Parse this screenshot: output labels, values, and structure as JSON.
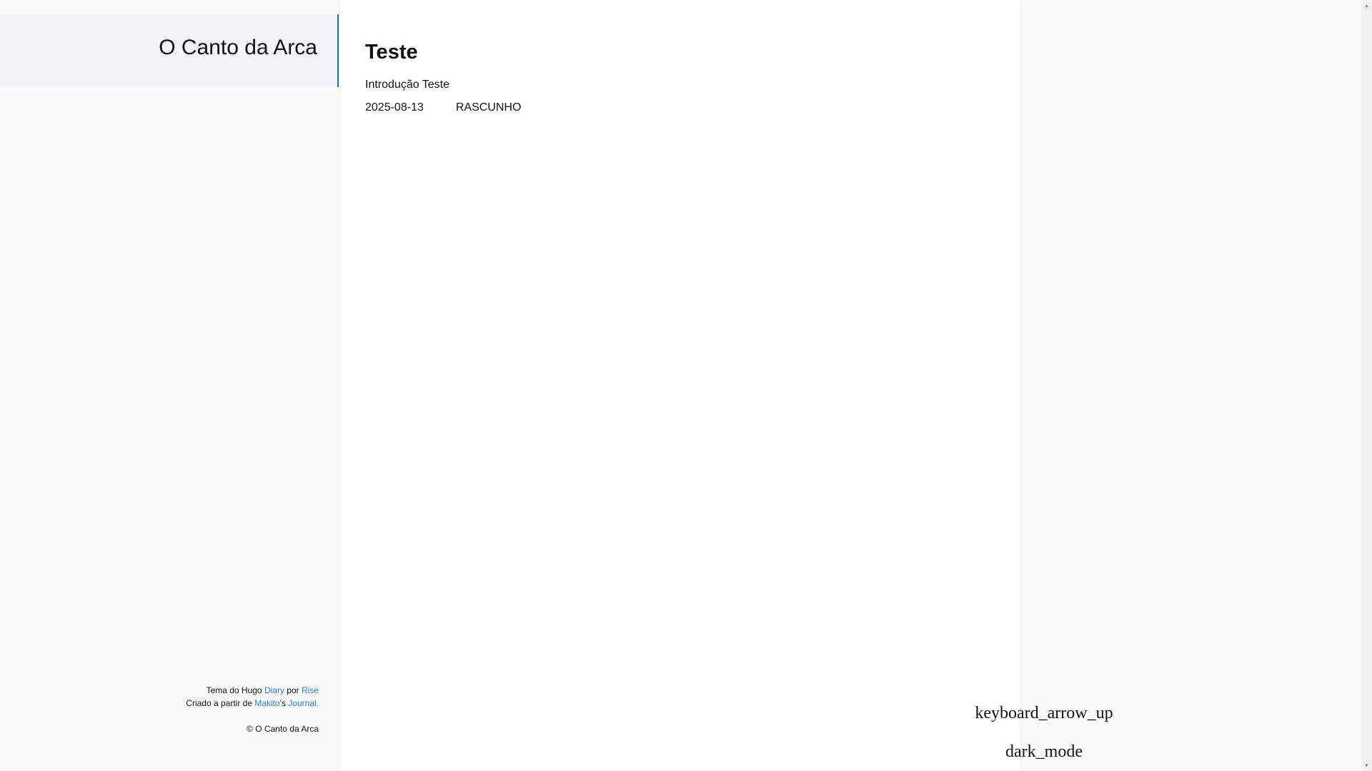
{
  "site": {
    "title": "O Canto da Arca"
  },
  "post": {
    "title": "Teste",
    "intro": "Introdução Teste",
    "date": "2025-08-13",
    "status": "RASCUNHO"
  },
  "footer": {
    "theme_prefix": "Tema do Hugo ",
    "theme_link": "Diary",
    "by": " por ",
    "author_link": "Rise",
    "based_prefix": "Criado a partir de ",
    "based_author_link": "Makito",
    "based_possessive": "'s ",
    "based_work_link": "Journal.",
    "copyright": "© O Canto da Arca"
  },
  "controls": {
    "scroll_top_icon": "keyboard_arrow_up",
    "dark_mode_icon": "dark_mode"
  },
  "colors": {
    "accent": "#1e6fc8",
    "link": "#2a7ad2"
  }
}
